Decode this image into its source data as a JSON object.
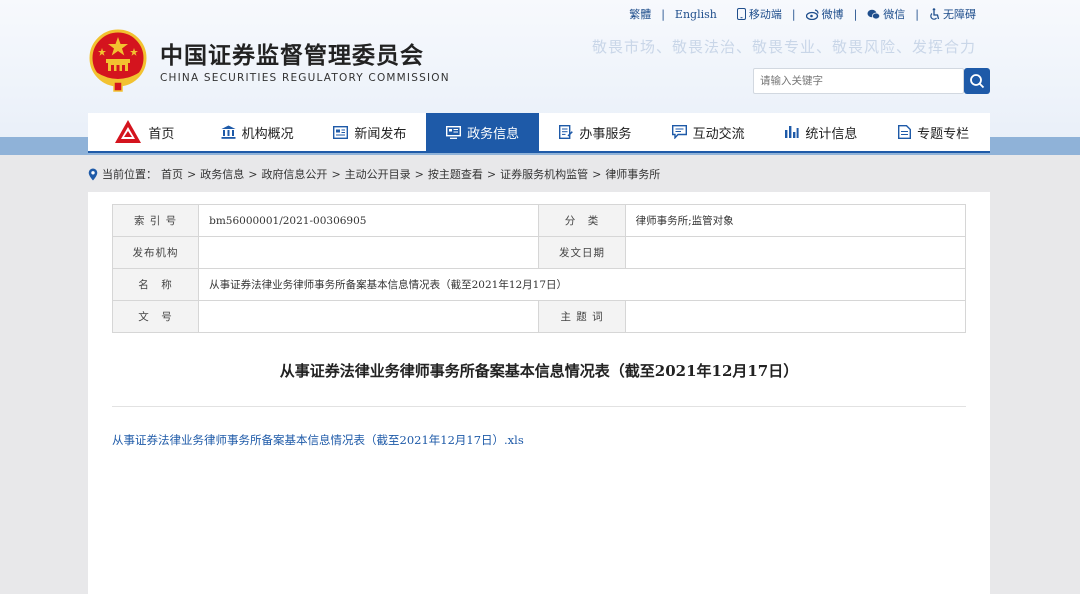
{
  "header": {
    "title_cn": "中国证券监督管理委员会",
    "title_en": "CHINA SECURITIES REGULATORY COMMISSION",
    "slogan": "敬畏市场、敬畏法治、敬畏专业、敬畏风险、发挥合力",
    "toplinks": [
      "繁體",
      "English",
      "移动端",
      "微博",
      "微信",
      "无障碍"
    ],
    "search": {
      "placeholder": "请输入关键字"
    }
  },
  "nav": {
    "items": [
      {
        "label": "首页",
        "icon": "home-logo-icon"
      },
      {
        "label": "机构概况",
        "icon": "building-icon"
      },
      {
        "label": "新闻发布",
        "icon": "news-icon"
      },
      {
        "label": "政务信息",
        "icon": "monitor-icon",
        "active": true
      },
      {
        "label": "办事服务",
        "icon": "document-icon"
      },
      {
        "label": "互动交流",
        "icon": "chat-icon"
      },
      {
        "label": "统计信息",
        "icon": "bar-chart-icon"
      },
      {
        "label": "专题专栏",
        "icon": "file-icon"
      }
    ]
  },
  "breadcrumb": {
    "prefix": "当前位置：",
    "items": [
      "首页",
      "政务信息",
      "政府信息公开",
      "主动公开目录",
      "按主题查看",
      "证券服务机构监管",
      "律师事务所"
    ]
  },
  "meta": {
    "index_label": "索 引 号",
    "index_value": "bm56000001/2021-00306905",
    "category_label": "分　类",
    "category_value": "律师事务所;监管对象",
    "publisher_label": "发布机构",
    "publisher_value": "",
    "date_label": "发文日期",
    "date_value": "",
    "name_label": "名　称",
    "name_value": "从事证券法律业务律师事务所备案基本信息情况表（截至2021年12月17日）",
    "docno_label": "文　号",
    "docno_value": "",
    "keywords_label": "主 题 词",
    "keywords_value": ""
  },
  "document": {
    "title": "从事证券法律业务律师事务所备案基本信息情况表（截至2021年12月17日）",
    "attachment": "从事证券法律业务律师事务所备案基本信息情况表（截至2021年12月17日）.xls"
  },
  "colors": {
    "brand_blue": "#1e5aa8",
    "emblem_red": "#d4141e",
    "emblem_gold": "#f2c230"
  }
}
